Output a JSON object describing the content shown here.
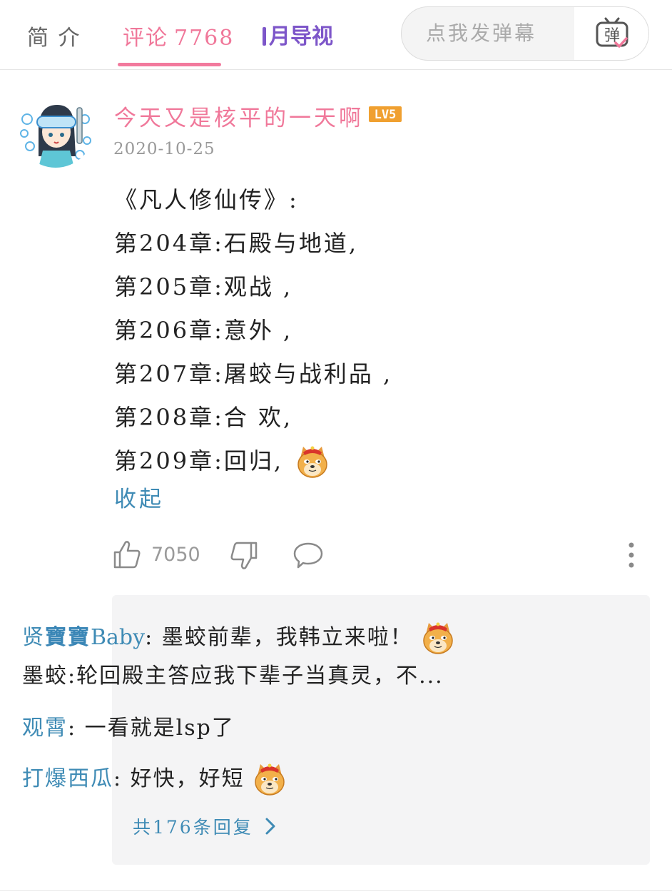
{
  "tabs": {
    "intro": "简 介",
    "comments_label": "评论",
    "comments_count": "7768",
    "guide": "月导视"
  },
  "danmaku": {
    "placeholder": "点我发弹幕",
    "button_glyph": "弹"
  },
  "comment": {
    "username": "今天又是核平的一天啊",
    "level": "LV5",
    "date": "2020-10-25",
    "lines": [
      "《凡人修仙传》:",
      "第204章:石殿与地道,",
      "第205章:观战 ,",
      "第206章:意外 ,",
      "第207章:屠蛟与战利品 ,",
      "第208章:合 欢,",
      "第209章:回归,"
    ],
    "collapse": "收起",
    "likes": "7050"
  },
  "replies": {
    "items": [
      {
        "name_prefix": "贤",
        "name_bold": "寶寶",
        "name_latin": "Baby",
        "text": ": 墨蛟前辈，我韩立来啦！",
        "text2": "墨蛟:轮回殿主答应我下辈子当真灵，不..."
      },
      {
        "name": "观霄",
        "text": ": 一看就是lsp了"
      },
      {
        "name": "打爆西瓜",
        "text": ": 好快，好短"
      }
    ],
    "view_all": "共176条回复"
  },
  "colors": {
    "accent_pink": "#f0789a",
    "accent_purple": "#7d56c9",
    "link_blue": "#3f8bb5",
    "level_orange": "#f0a030"
  },
  "icons": [
    "danmaku-tv-icon",
    "like-icon",
    "dislike-icon",
    "reply-icon",
    "more-icon",
    "doge-emoji",
    "chevron-right-icon"
  ]
}
